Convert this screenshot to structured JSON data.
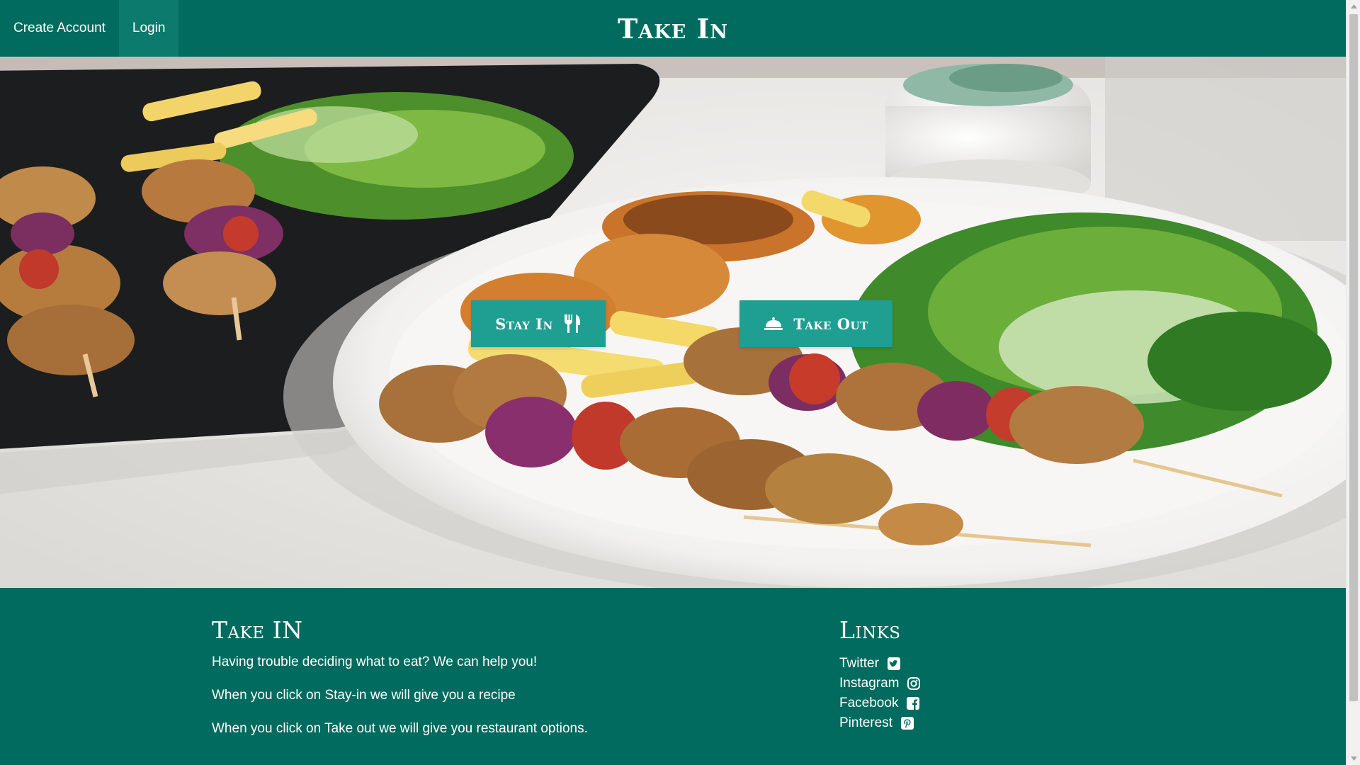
{
  "nav": {
    "create_account": "Create Account",
    "login": "Login",
    "brand": "Take In"
  },
  "hero": {
    "image_description_icon": "food-photo",
    "stay_in_label": "Stay In",
    "stay_in_icon": "fork-knife-icon",
    "take_out_label": "Take Out",
    "take_out_icon": "cloche-icon"
  },
  "footer": {
    "about": {
      "heading": "Take IN",
      "lines": [
        "Having trouble deciding what to eat? We can help you!",
        "When you click on Stay-in we will give you a recipe",
        "When you click on Take out we will give you restaurant options."
      ]
    },
    "links": {
      "heading": "Links",
      "items": [
        {
          "label": "Twitter",
          "icon": "twitter-icon"
        },
        {
          "label": "Instagram",
          "icon": "instagram-icon"
        },
        {
          "label": "Facebook",
          "icon": "facebook-icon"
        },
        {
          "label": "Pinterest",
          "icon": "pinterest-icon"
        }
      ]
    }
  },
  "colors": {
    "nav_bg": "#006b5e",
    "nav_active": "#0c7a6c",
    "button_bg": "#1f9e92",
    "footer_bg": "#006b5e"
  }
}
